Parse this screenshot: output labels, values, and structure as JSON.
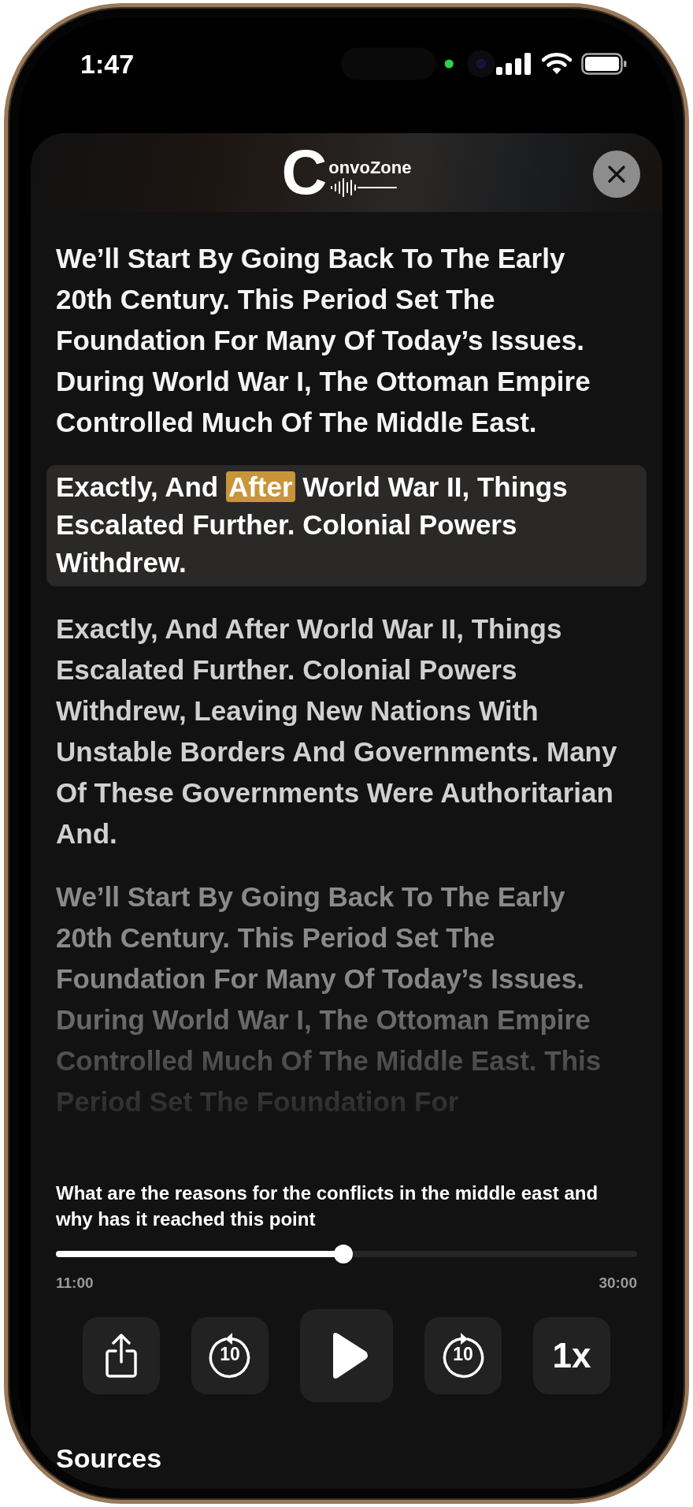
{
  "status_bar": {
    "time": "1:47"
  },
  "header": {
    "logo": {
      "initial": "C",
      "rest": "onvoZone"
    }
  },
  "transcript": [
    {
      "kind": "read",
      "text": "We’ll Start By Going Back To The Early 20th Century. This Period Set The Foundation For Many Of Today’s Issues. During World War I, The Ottoman Empire Controlled Much Of The Middle East."
    },
    {
      "kind": "current",
      "before": "Exactly, And ",
      "highlight": "After",
      "after": " World War II, Things Escalated Further. Colonial Powers Withdrew."
    },
    {
      "kind": "upcoming",
      "text": "Exactly, And After World War II, Things Escalated Further. Colonial Powers Withdrew, Leaving New Nations With Unstable Borders And Governments. Many Of These Governments Were Authoritarian And."
    },
    {
      "kind": "faded",
      "text": "We’ll Start By Going Back To The Early 20th Century. This Period Set The Foundation For Many Of Today’s Issues. During World War I, The Ottoman Empire Controlled Much Of The Middle East.  This Period Set The Foundation For"
    }
  ],
  "player": {
    "question": "What are the reasons for the conflicts in the middle east and why has it reached this point",
    "progress": {
      "level": 0.495,
      "elapsed": "11:00",
      "total": "30:00"
    },
    "controls": [
      {
        "kind": "share"
      },
      {
        "kind": "rewind",
        "label": "10"
      },
      {
        "kind": "play"
      },
      {
        "kind": "forward",
        "label": "10"
      },
      {
        "kind": "speed",
        "label": "1x"
      }
    ]
  },
  "sources": {
    "title": "Sources"
  }
}
